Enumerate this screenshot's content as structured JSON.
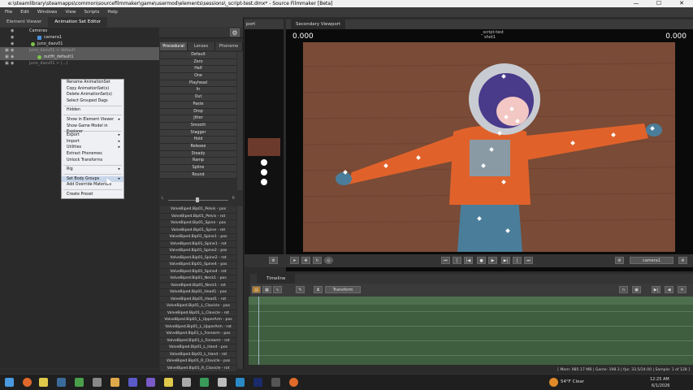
{
  "window": {
    "title": "e:\\steamlibrary\\steamapps\\common\\sourcefilmmaker\\game\\usermod\\elements\\sessions\\_script-test.dmx* - Source Filmmaker [Beta]",
    "minimize": "—",
    "maximize": "☐",
    "close": "✕"
  },
  "menubar": [
    "File",
    "Edit",
    "Windows",
    "View",
    "Scripts",
    "Help"
  ],
  "left_tabs": [
    "Element Viewer",
    "Animation Set Editor"
  ],
  "add_button": "+",
  "gear": "⚙",
  "tree": [
    {
      "label": "Cameras",
      "indent": 0
    },
    {
      "label": "camera1",
      "indent": 1
    },
    {
      "label": "juno_dasv01",
      "indent": 0
    },
    {
      "label": "juno_dasv01 > default",
      "indent": 0
    },
    {
      "label": "outfit_default1",
      "indent": 1
    },
    {
      "label": "juno_dasv01 > (...)",
      "indent": 0
    }
  ],
  "context_menu": {
    "groups": [
      [
        "Rename AnimationSet",
        "Copy AnimationSet(s)",
        "Delete AnimationSet(s)",
        "Select Grouped Dags"
      ],
      [
        "Hidden"
      ],
      [
        "Show in Element Viewer",
        "Show Game Model in Explorer"
      ],
      [
        "Export",
        "Import",
        "Utilities",
        "Extract Phonemes",
        "Unlock Transforms"
      ],
      [
        "Rig"
      ],
      [
        "Set Body Groups",
        "Add Override Materials"
      ],
      [
        "Create Preset"
      ]
    ],
    "submenu_items": [
      "Show in Element Viewer",
      "Export",
      "Import",
      "Utilities",
      "Rig",
      "Set Body Groups"
    ],
    "highlighted": "Set Body Groups",
    "arrow": "▸"
  },
  "proc_tabs": [
    "Procedural",
    "Lenses",
    "Phoneme"
  ],
  "proc_buttons": [
    "Default",
    "Zero",
    "Half",
    "One",
    "Playhead",
    "In",
    "Out",
    "Paste",
    "Drop",
    "Jitter",
    "Smooth",
    "Stagger",
    "Hold",
    "Release",
    "Steady",
    "Ramp",
    "Spline",
    "Round"
  ],
  "slider_labels": {
    "left": "L",
    "right": "R"
  },
  "tracks": [
    "ValveBiped.Bip01_Pelvis - pos",
    "ValveBiped.Bip01_Pelvis - rot",
    "ValveBiped.Bip01_Spine - pos",
    "ValveBiped.Bip01_Spine - rot",
    "ValveBiped.Bip01_Spine1 - pos",
    "ValveBiped.Bip01_Spine1 - rot",
    "ValveBiped.Bip01_Spine2 - pos",
    "ValveBiped.Bip01_Spine2 - rot",
    "ValveBiped.Bip01_Spine4 - pos",
    "ValveBiped.Bip01_Spine4 - rot",
    "ValveBiped.Bip01_Neck1 - pos",
    "ValveBiped.Bip01_Neck1 - rot",
    "ValveBiped.Bip01_Head1 - pos",
    "ValveBiped.Bip01_Head1 - rot",
    "ValveBiped.Bip01_L_Clavicle - pos",
    "ValveBiped.Bip01_L_Clavicle - rot",
    "ValveBiped.Bip01_L_UpperArm - pos",
    "ValveBiped.Bip01_L_UpperArm - rot",
    "ValveBiped.Bip01_L_Forearm - pos",
    "ValveBiped.Bip01_L_Forearm - rot",
    "ValveBiped.Bip01_L_Hand - pos",
    "ValveBiped.Bip01_L_Hand - rot",
    "ValveBiped.Bip01_R_Clavicle - pos",
    "ValveBiped.Bip01_R_Clavicle - rot"
  ],
  "viewport": {
    "left_tab": "port",
    "secondary_tab": "Secondary Viewport",
    "left_value": "0.000",
    "right_value": "0.000",
    "session": "_script-test",
    "shot": "shot1",
    "camera": "camera1"
  },
  "timeline": {
    "tab": "Timeline",
    "transform": "Transform"
  },
  "status": "[ Mem:   985.17 MB | Game:   198.3 | fps:   33.5/24.00 | Sample:   1 of 128 ]",
  "taskbar": {
    "weather": "54°F  Clear",
    "time": "12:25 AM",
    "date": "6/1/2026"
  }
}
